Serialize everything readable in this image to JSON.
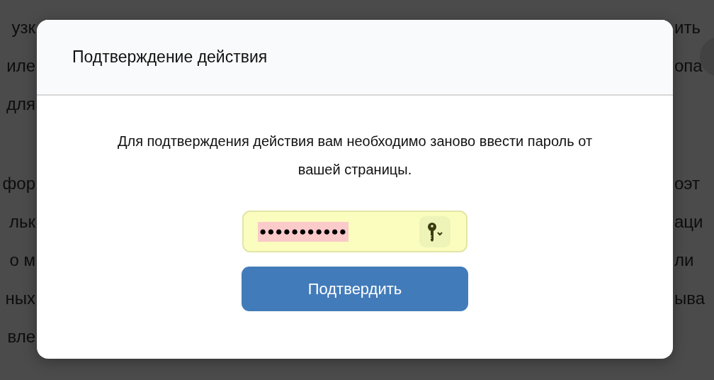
{
  "background_top": [
    {
      "left": "узк",
      "right": "ить"
    },
    {
      "left": "иле",
      "right": "опа"
    },
    {
      "left": "для"
    }
  ],
  "background_bottom": [
    {
      "left": "фор",
      "right": "оэт"
    },
    {
      "left": "льк",
      "right": "аци"
    },
    {
      "left": "о м",
      "right": "ли"
    },
    {
      "left": "ных",
      "right": "ыва"
    },
    {
      "left": "вле"
    }
  ],
  "dialog": {
    "title": "Подтверждение действия",
    "message": "Для подтверждения действия вам необходимо заново ввести пароль от вашей страницы.",
    "password": {
      "value": "●●●●●●●●●●●",
      "autofilled": true
    },
    "confirm_button": "Подтвердить"
  }
}
